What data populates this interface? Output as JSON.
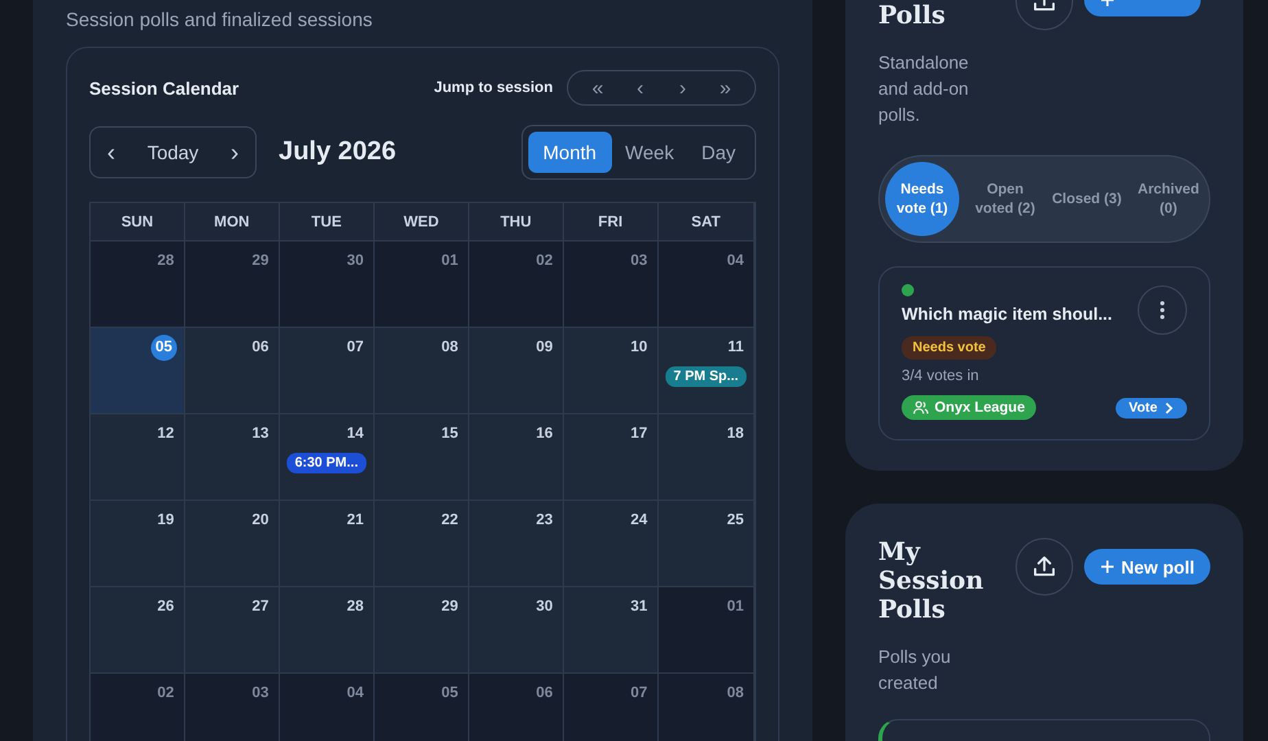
{
  "calendar_panel": {
    "subtitle": "Session polls and finalized sessions",
    "calendar": {
      "title": "Session Calendar",
      "jump_label": "Jump to session",
      "jump_buttons": [
        "«",
        "‹",
        "›",
        "»"
      ],
      "nav": {
        "prev": "‹",
        "today": "Today",
        "next": "›"
      },
      "month_label": "July 2026",
      "views": [
        {
          "label": "Month",
          "selected": true
        },
        {
          "label": "Week",
          "selected": false
        },
        {
          "label": "Day",
          "selected": false
        }
      ],
      "weekdays": [
        "SUN",
        "MON",
        "TUE",
        "WED",
        "THU",
        "FRI",
        "SAT"
      ],
      "weeks": [
        [
          {
            "day": "28",
            "in_month": false
          },
          {
            "day": "29",
            "in_month": false
          },
          {
            "day": "30",
            "in_month": false
          },
          {
            "day": "01",
            "in_month": false
          },
          {
            "day": "02",
            "in_month": false
          },
          {
            "day": "03",
            "in_month": false
          },
          {
            "day": "04",
            "in_month": false
          }
        ],
        [
          {
            "day": "05",
            "in_month": true,
            "today": true
          },
          {
            "day": "06",
            "in_month": true
          },
          {
            "day": "07",
            "in_month": true
          },
          {
            "day": "08",
            "in_month": true
          },
          {
            "day": "09",
            "in_month": true
          },
          {
            "day": "10",
            "in_month": true
          },
          {
            "day": "11",
            "in_month": true,
            "events": [
              {
                "label": "7 PM Sp...",
                "color": "#177d8f"
              }
            ]
          }
        ],
        [
          {
            "day": "12",
            "in_month": true
          },
          {
            "day": "13",
            "in_month": true
          },
          {
            "day": "14",
            "in_month": true,
            "events": [
              {
                "label": "6:30 PM...",
                "color": "#1d4fd6"
              }
            ]
          },
          {
            "day": "15",
            "in_month": true
          },
          {
            "day": "16",
            "in_month": true
          },
          {
            "day": "17",
            "in_month": true
          },
          {
            "day": "18",
            "in_month": true
          }
        ],
        [
          {
            "day": "19",
            "in_month": true
          },
          {
            "day": "20",
            "in_month": true
          },
          {
            "day": "21",
            "in_month": true
          },
          {
            "day": "22",
            "in_month": true
          },
          {
            "day": "23",
            "in_month": true
          },
          {
            "day": "24",
            "in_month": true
          },
          {
            "day": "25",
            "in_month": true
          }
        ],
        [
          {
            "day": "26",
            "in_month": true
          },
          {
            "day": "27",
            "in_month": true
          },
          {
            "day": "28",
            "in_month": true
          },
          {
            "day": "29",
            "in_month": true
          },
          {
            "day": "30",
            "in_month": true
          },
          {
            "day": "31",
            "in_month": true
          },
          {
            "day": "01",
            "in_month": false
          }
        ],
        [
          {
            "day": "02",
            "in_month": false
          },
          {
            "day": "03",
            "in_month": false
          },
          {
            "day": "04",
            "in_month": false
          },
          {
            "day": "05",
            "in_month": false
          },
          {
            "day": "06",
            "in_month": false
          },
          {
            "day": "07",
            "in_month": false
          },
          {
            "day": "08",
            "in_month": false
          }
        ]
      ]
    }
  },
  "poll_cards": [
    {
      "title": "Polls",
      "subtitle": "Standalone and add-on polls.",
      "filters": [
        {
          "label": "Needs vote (1)",
          "selected": true
        },
        {
          "label": "Open voted (2)",
          "selected": false
        },
        {
          "label": "Closed (3)",
          "selected": false
        },
        {
          "label": "Archived (0)",
          "selected": false
        }
      ],
      "polls": [
        {
          "color": "#2ea44f",
          "accent": false,
          "title": "Which magic item shoul...",
          "badge": "Needs vote",
          "votes": "3/4 votes in",
          "group": "Onyx League",
          "action": "Vote"
        }
      ]
    },
    {
      "title": "My Session Polls",
      "subtitle": "Polls you created",
      "new_button": "New poll",
      "polls": [
        {
          "accent": true
        }
      ]
    }
  ]
}
